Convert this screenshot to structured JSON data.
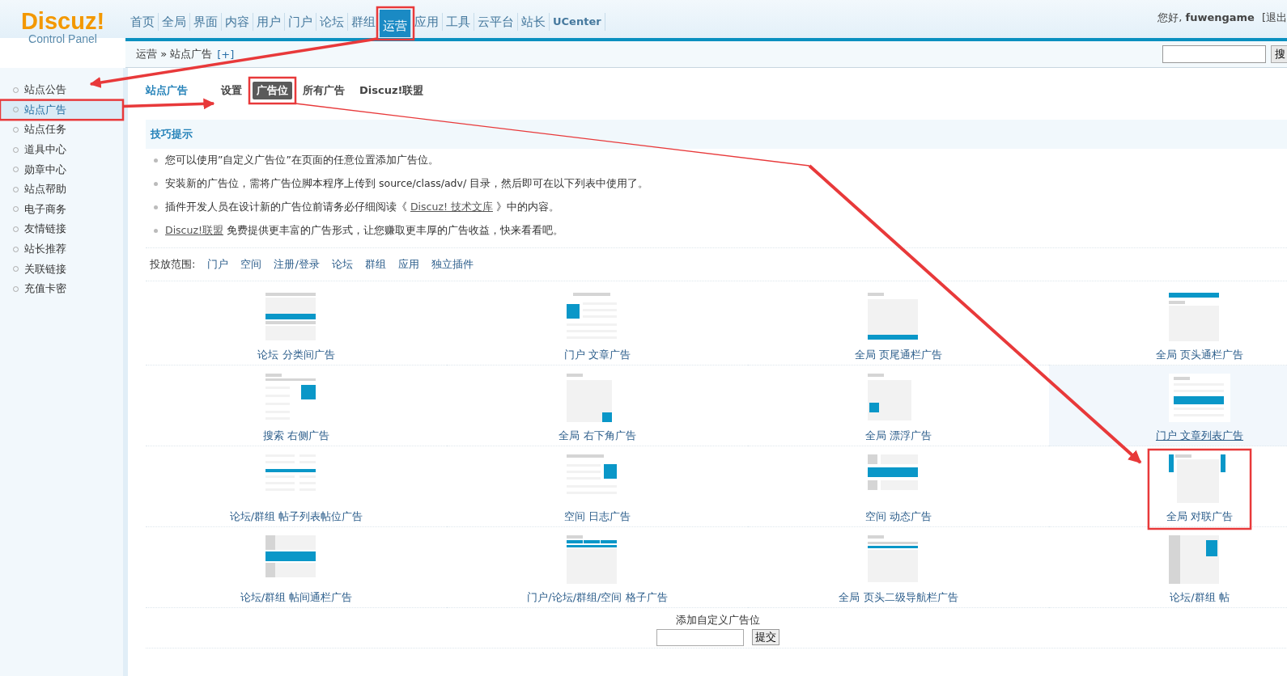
{
  "logo": {
    "title": "Discuz!",
    "subtitle": "Control Panel"
  },
  "nav": [
    {
      "label": "首页",
      "selected": false
    },
    {
      "label": "全局",
      "selected": false
    },
    {
      "label": "界面",
      "selected": false
    },
    {
      "label": "内容",
      "selected": false
    },
    {
      "label": "用户",
      "selected": false
    },
    {
      "label": "门户",
      "selected": false
    },
    {
      "label": "论坛",
      "selected": false
    },
    {
      "label": "群组",
      "selected": false
    },
    {
      "label": "运营",
      "selected": true
    },
    {
      "label": "应用",
      "selected": false
    },
    {
      "label": "工具",
      "selected": false
    },
    {
      "label": "云平台",
      "selected": false
    },
    {
      "label": "站长",
      "selected": false
    },
    {
      "label": "UCenter",
      "selected": false
    }
  ],
  "user": {
    "greeting": "您好, **fuwengame**",
    "logout": "[退出"
  },
  "breadcrumb": {
    "text": "运营 » 站点广告",
    "add": "[+]"
  },
  "search": {
    "button": "搜"
  },
  "sidebar": {
    "items": [
      {
        "label": "站点公告",
        "selected": false
      },
      {
        "label": "站点广告",
        "selected": true
      },
      {
        "label": "站点任务",
        "selected": false
      },
      {
        "label": "道具中心",
        "selected": false
      },
      {
        "label": "勋章中心",
        "selected": false
      },
      {
        "label": "站点帮助",
        "selected": false
      },
      {
        "label": "电子商务",
        "selected": false
      },
      {
        "label": "友情链接",
        "selected": false
      },
      {
        "label": "站长推荐",
        "selected": false
      },
      {
        "label": "关联链接",
        "selected": false
      },
      {
        "label": "充值卡密",
        "selected": false
      }
    ]
  },
  "page_title": "站点广告",
  "tabs": [
    {
      "label": "设置",
      "selected": false
    },
    {
      "label": "广告位",
      "selected": true
    },
    {
      "label": "所有广告",
      "selected": false
    },
    {
      "label": "Discuz!联盟",
      "selected": false
    }
  ],
  "tips": {
    "title": "技巧提示",
    "items": [
      {
        "text": "您可以使用”自定义广告位”在页面的任意位置添加广告位。"
      },
      {
        "text": "安装新的广告位，需将广告位脚本程序上传到 source/class/adv/ 目录，然后即可在以下列表中使用了。"
      },
      {
        "text": "插件开发人员在设计新的广告位前请务必仔细阅读《 ",
        "link": "Discuz! 技术文库",
        "after": " 》中的内容。"
      },
      {
        "link": "Discuz!联盟",
        "after": " 免费提供更丰富的广告形式，让您赚取更丰厚的广告收益，快来看看吧。"
      }
    ]
  },
  "scope": {
    "label": "投放范围:",
    "links": [
      "门户",
      "空间",
      "注册/登录",
      "论坛",
      "群组",
      "应用",
      "独立插件"
    ]
  },
  "ad_slots": [
    {
      "label": "论坛 分类间广告",
      "highlighted": false
    },
    {
      "label": "门户 文章广告",
      "highlighted": false
    },
    {
      "label": "全局 页尾通栏广告",
      "highlighted": false
    },
    {
      "label": "全局 页头通栏广告",
      "highlighted": false
    },
    {
      "label": "搜索 右侧广告",
      "highlighted": false
    },
    {
      "label": "全局 右下角广告",
      "highlighted": false
    },
    {
      "label": "全局 漂浮广告",
      "highlighted": false
    },
    {
      "label": "门户 文章列表广告",
      "highlighted": true
    },
    {
      "label": "论坛/群组 帖子列表帖位广告",
      "highlighted": false
    },
    {
      "label": "空间 日志广告",
      "highlighted": false
    },
    {
      "label": "空间 动态广告",
      "highlighted": false
    },
    {
      "label": "全局 对联广告",
      "highlighted": false,
      "framed": true
    },
    {
      "label": "论坛/群组 帖间通栏广告",
      "highlighted": false
    },
    {
      "label": "门户/论坛/群组/空间 格子广告",
      "highlighted": false
    },
    {
      "label": "全局 页头二级导航栏广告",
      "highlighted": false
    },
    {
      "label": "论坛/群组 帖",
      "highlighted": false
    }
  ],
  "custom": {
    "label": "添加自定义广告位",
    "submit": "提交"
  }
}
